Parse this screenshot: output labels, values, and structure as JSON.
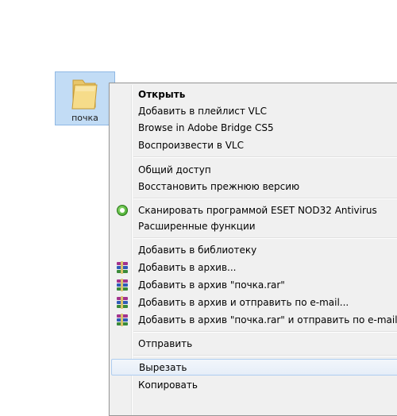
{
  "desktop": {
    "folder": {
      "label": "почка",
      "icon": "folder-icon"
    }
  },
  "context_menu": {
    "items": [
      {
        "label": "Открыть",
        "bold": true
      },
      {
        "label": "Добавить в плейлист VLC"
      },
      {
        "label": "Browse in Adobe Bridge CS5"
      },
      {
        "label": "Воспроизвести в VLC"
      },
      {
        "label": "Общий доступ",
        "submenu": true
      },
      {
        "label": "Восстановить прежнюю версию"
      },
      {
        "label": "Сканировать программой ESET NOD32 Antivirus",
        "icon": "eset-icon"
      },
      {
        "label": "Расширенные функции",
        "submenu": true
      },
      {
        "label": "Добавить в библиотеку",
        "submenu": true
      },
      {
        "label": "Добавить в архив...",
        "icon": "winrar-icon"
      },
      {
        "label": "Добавить в архив \"почка.rar\"",
        "icon": "winrar-icon"
      },
      {
        "label": "Добавить в архив и отправить по e-mail...",
        "icon": "winrar-icon"
      },
      {
        "label": "Добавить в архив \"почка.rar\" и отправить по e-mail",
        "icon": "winrar-icon"
      },
      {
        "label": "Отправить",
        "submenu": true
      },
      {
        "label": "Вырезать",
        "highlighted": true
      },
      {
        "label": "Копировать"
      }
    ]
  },
  "colors": {
    "menu_background": "#f0f0f0",
    "selection_background": "#c2dcf5",
    "hover_border": "#aecdf0"
  }
}
